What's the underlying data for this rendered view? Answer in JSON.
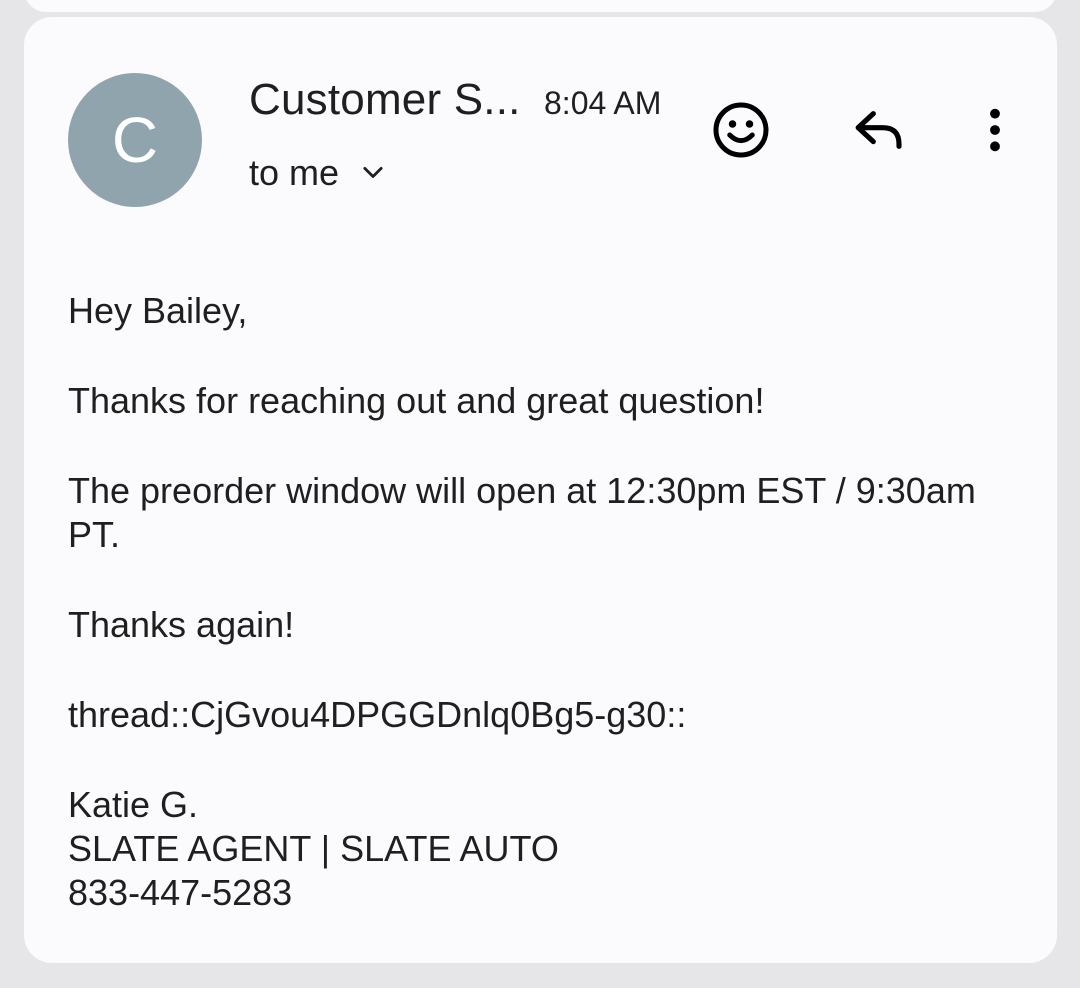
{
  "email": {
    "avatar_letter": "C",
    "avatar_color": "#90a4ae",
    "sender": "Customer S...",
    "time": "8:04 AM",
    "recipient_label": "to me",
    "icons": {
      "emoji": "add-reaction-icon",
      "reply": "reply-icon",
      "more": "more-vert-icon",
      "recipient_toggle": "chevron-down-icon"
    },
    "body": {
      "greeting": "Hey Bailey,",
      "line1": "Thanks for reaching out and great question!",
      "line2": "The preorder window will open at 12:30pm EST / 9:30am PT.",
      "line3": "Thanks again!",
      "thread": "thread::CjGvou4DPGGDnlq0Bg5-g30::",
      "signature_name": "Katie G.",
      "signature_title": "SLATE AGENT | SLATE AUTO",
      "signature_phone": "833-447-5283"
    }
  }
}
